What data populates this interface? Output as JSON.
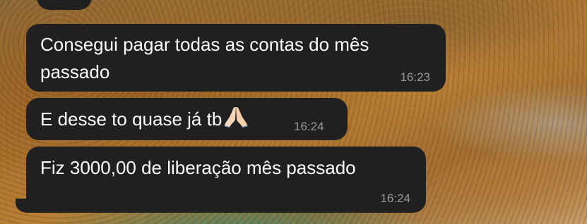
{
  "messages": [
    {
      "text": "Consegui pagar todas as contas do mês passado",
      "time": "16:23"
    },
    {
      "text": "E desse to quase já tb",
      "emoji": "folded-hands-icon",
      "time": "16:24"
    },
    {
      "text": "Fiz 3000,00 de liberação mês passado",
      "time": "16:24"
    }
  ],
  "colors": {
    "bubble": "#202020",
    "text": "#ffffff",
    "timestamp": "#9a9a9a"
  }
}
